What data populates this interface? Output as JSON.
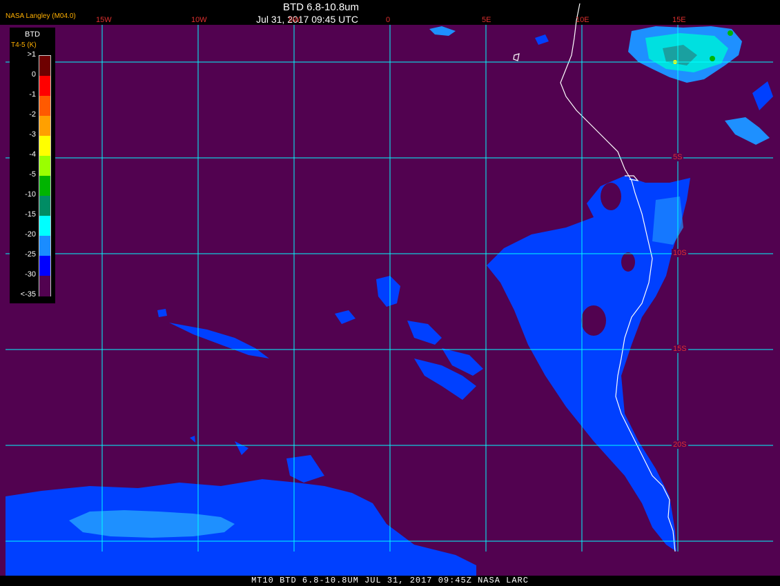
{
  "header": {
    "org": "NASA Langley (M04.0)",
    "title": "BTD 6.8-10.8um",
    "subtitle": "Jul 31, 2017 09:45 UTC"
  },
  "footer": "MT10  BTD 6.8-10.8UM   JUL 31, 2017 09:45Z   NASA LARC",
  "grid": {
    "longitude_labels": [
      "15W",
      "10W",
      "5W",
      "0",
      "5E",
      "10E",
      "15E"
    ],
    "latitude_labels": [
      "5S",
      "10S",
      "15S",
      "20S"
    ]
  },
  "legend": {
    "title": "BTD",
    "units": "T4-5 (K)",
    "ticks": [
      ">1",
      "0",
      "-1",
      "-2",
      "-3",
      "-4",
      "-5",
      "-10",
      "-15",
      "-20",
      "-25",
      "-30",
      "<-35"
    ],
    "colors": [
      "#6e0000",
      "#ff0000",
      "#ff5a00",
      "#ffa000",
      "#ffff00",
      "#9aff00",
      "#00b400",
      "#008c64",
      "#00ffff",
      "#1a8cff",
      "#0000ff",
      "#520250"
    ]
  },
  "colors": {
    "background": "#520250",
    "grid": "#00ffff",
    "coast": "#ffffff",
    "cloud_blue": "#0040ff",
    "cloud_light": "#1e90ff"
  }
}
